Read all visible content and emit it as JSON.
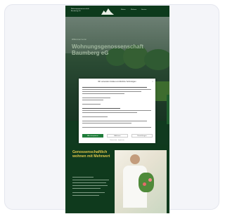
{
  "header": {
    "logo_text": "Wohnungsgenossenschaft Baumberg eG",
    "nav": [
      "Mieten",
      "Wohnen",
      "Service"
    ]
  },
  "hero": {
    "kicker": "Willkommen bei der",
    "title": "Wohnungsgenossenschaft Baumberg eG"
  },
  "cookie_dialog": {
    "title": "Wir verwenden Cookies und ähnliche Technologien",
    "close_label": "×",
    "accept_label": "Alle akzeptieren",
    "reject_label": "Ablehnen",
    "settings_label": "Einstellungen",
    "footer_text": "Datenschutz · Impressum"
  },
  "section2": {
    "title": "Genossenschaftlich wohnen mit Mehrwert",
    "colors": {
      "title": "#e0c64a",
      "background": "#0f3a1d"
    }
  },
  "colors": {
    "header_bg": "#0d3a1c",
    "accept_button": "#1f7d3a"
  }
}
